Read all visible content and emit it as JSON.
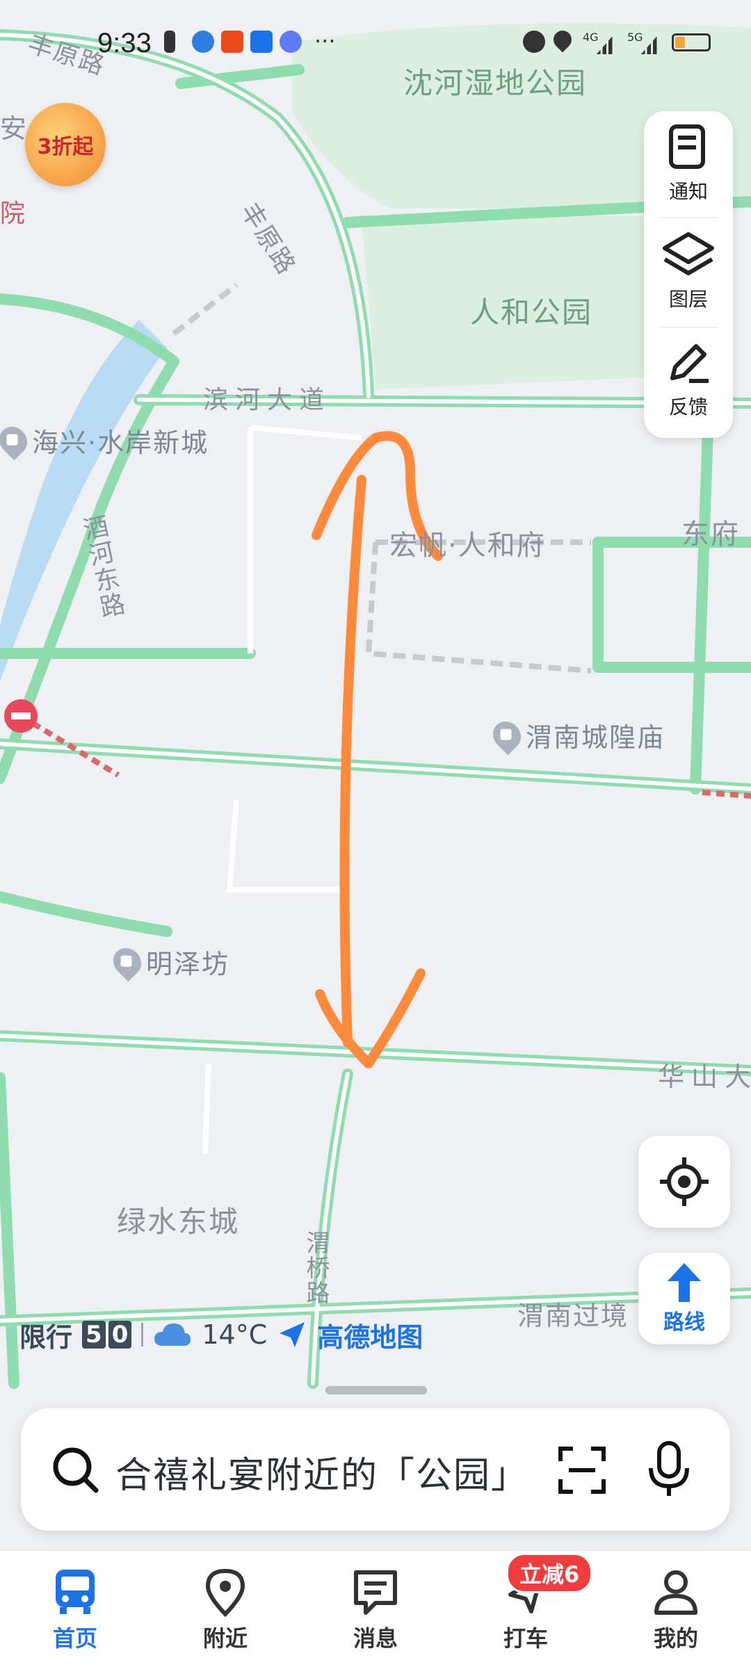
{
  "status_bar": {
    "time": "9:33",
    "more": "···",
    "net1": "4G",
    "net2": "5G"
  },
  "map": {
    "labels": {
      "fengyuan_road_top": "丰原路",
      "fengyuan_road": "丰原路",
      "park_top": "沈河湿地公园",
      "scenic_partial": "安  景园",
      "hospital_partial": "院",
      "renhe_park": "人和公园",
      "binhe_avenue": "滨河大道",
      "haixing": "海兴·水岸新城",
      "jiuhe_east_road": "酒河东路",
      "hongfan_renhe": "宏帆·人和府",
      "dongfu_partial": "东府",
      "weinan_temple": "渭南城隍庙",
      "mingze": "明泽坊",
      "huashan_partial": "华山大",
      "lvshui": "绿水东城",
      "weiqiao_road": "渭桥路",
      "weinan_pass": "渭南过境"
    },
    "promo_text": "3折起"
  },
  "side_panel": {
    "notice": "通知",
    "layers": "图层",
    "feedback": "反馈"
  },
  "route_button": "路线",
  "info_bar": {
    "restriction_label": "限行",
    "plate1": "5",
    "plate2": "0",
    "temperature": "14°C",
    "brand": "高德地图"
  },
  "search": {
    "placeholder": "合禧礼宴附近的「公园」"
  },
  "tabs": [
    {
      "label": "首页"
    },
    {
      "label": "附近"
    },
    {
      "label": "消息"
    },
    {
      "label": "打车"
    },
    {
      "label": "我的"
    }
  ],
  "taxi_badge": "立减6",
  "colors": {
    "road": "#8fdcae",
    "park": "#dcefe1",
    "water": "#b9dcf4",
    "accent": "#1a73e8",
    "arrow": "#ff8a3c"
  }
}
